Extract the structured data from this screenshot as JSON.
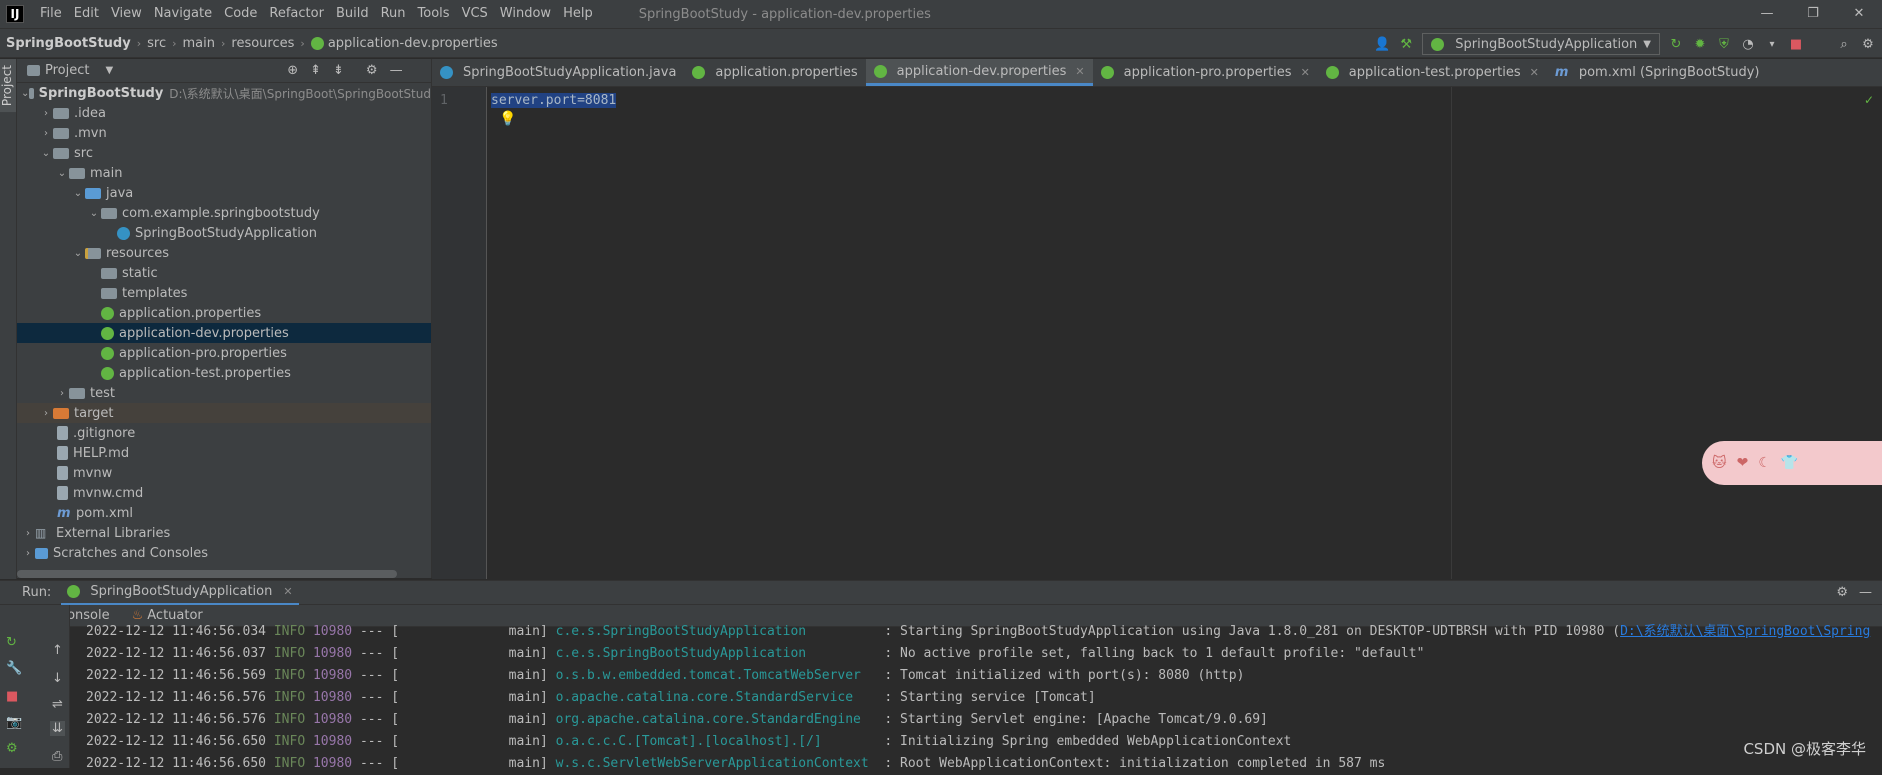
{
  "window": {
    "title": "SpringBootStudy - application-dev.properties",
    "logo": "IJ"
  },
  "menu": [
    "File",
    "Edit",
    "View",
    "Navigate",
    "Code",
    "Refactor",
    "Build",
    "Run",
    "Tools",
    "VCS",
    "Window",
    "Help"
  ],
  "breadcrumb": [
    "SpringBootStudy",
    "src",
    "main",
    "resources",
    "application-dev.properties"
  ],
  "run_config": "SpringBootStudyApplication",
  "project": {
    "header": "Project",
    "strip_label": "Project",
    "root_name": "SpringBootStudy",
    "root_path": "D:\\系统默认\\桌面\\SpringBoot\\SpringBootStud",
    "tree": [
      ".idea",
      ".mvn",
      "src",
      "main",
      "java",
      "com.example.springbootstudy",
      "SpringBootStudyApplication",
      "resources",
      "static",
      "templates",
      "application.properties",
      "application-dev.properties",
      "application-pro.properties",
      "application-test.properties",
      "test",
      "target",
      ".gitignore",
      "HELP.md",
      "mvnw",
      "mvnw.cmd",
      "pom.xml",
      "External Libraries",
      "Scratches and Consoles"
    ]
  },
  "tabs": [
    "SpringBootStudyApplication.java",
    "application.properties",
    "application-dev.properties",
    "application-pro.properties",
    "application-test.properties",
    "pom.xml (SpringBootStudy)"
  ],
  "editor": {
    "line_number": "1",
    "code": "server.port=8081"
  },
  "run": {
    "label": "Run:",
    "config_tab": "SpringBootStudyApplication",
    "subtabs": [
      "Console",
      "Actuator"
    ],
    "console": [
      {
        "time": "2022-12-12 11:46:56.034",
        "level": "INFO",
        "pid": "10980",
        "sep": "--- [",
        "thread": "main]",
        "logger": "c.e.s.SpringBootStudyApplication         ",
        "msg": ": Starting SpringBootStudyApplication using Java 1.8.0_281 on DESKTOP-UDTBRSH with PID 10980 (",
        "link": "D:\\系统默认\\桌面\\SpringBoot\\Spring"
      },
      {
        "time": "2022-12-12 11:46:56.037",
        "level": "INFO",
        "pid": "10980",
        "sep": "--- [",
        "thread": "main]",
        "logger": "c.e.s.SpringBootStudyApplication         ",
        "msg": ": No active profile set, falling back to 1 default profile: \"default\"",
        "link": ""
      },
      {
        "time": "2022-12-12 11:46:56.569",
        "level": "INFO",
        "pid": "10980",
        "sep": "--- [",
        "thread": "main]",
        "logger": "o.s.b.w.embedded.tomcat.TomcatWebServer  ",
        "msg": ": Tomcat initialized with port(s): 8080 (http)",
        "link": ""
      },
      {
        "time": "2022-12-12 11:46:56.576",
        "level": "INFO",
        "pid": "10980",
        "sep": "--- [",
        "thread": "main]",
        "logger": "o.apache.catalina.core.StandardService   ",
        "msg": ": Starting service [Tomcat]",
        "link": ""
      },
      {
        "time": "2022-12-12 11:46:56.576",
        "level": "INFO",
        "pid": "10980",
        "sep": "--- [",
        "thread": "main]",
        "logger": "org.apache.catalina.core.StandardEngine  ",
        "msg": ": Starting Servlet engine: [Apache Tomcat/9.0.69]",
        "link": ""
      },
      {
        "time": "2022-12-12 11:46:56.650",
        "level": "INFO",
        "pid": "10980",
        "sep": "--- [",
        "thread": "main]",
        "logger": "o.a.c.c.C.[Tomcat].[localhost].[/]       ",
        "msg": ": Initializing Spring embedded WebApplicationContext",
        "link": ""
      },
      {
        "time": "2022-12-12 11:46:56.650",
        "level": "INFO",
        "pid": "10980",
        "sep": "--- [",
        "thread": "main]",
        "logger": "w.s.c.ServletWebServerApplicationContext ",
        "msg": ": Root WebApplicationContext: initialization completed in 587 ms",
        "link": ""
      }
    ]
  },
  "watermark": "CSDN @极客李华"
}
